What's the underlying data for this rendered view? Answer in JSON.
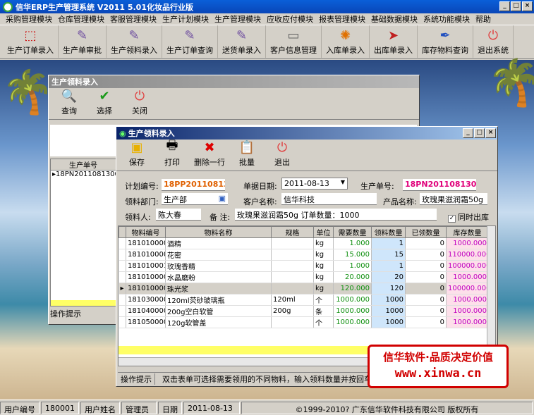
{
  "app": {
    "title": "信华ERP生产管理系统  V2011 5.01化妆品行业版"
  },
  "menu": [
    "采购管理模块",
    "仓库管理模块",
    "客服管理模块",
    "生产计划模块",
    "生产管理模块",
    "应收应付模块",
    "报表管理模块",
    "基础数据模块",
    "系统功能模块",
    "帮助"
  ],
  "toolbar": [
    {
      "label": "生产订单录入",
      "icon": "pdf-icon"
    },
    {
      "label": "生产单审批",
      "icon": "approve-icon"
    },
    {
      "label": "生产领料录入",
      "icon": "pick-icon"
    },
    {
      "label": "生产订单查询",
      "icon": "query-icon"
    },
    {
      "label": "送货单录入",
      "icon": "delivery-icon"
    },
    {
      "label": "客户信息管理",
      "icon": "customer-icon"
    },
    {
      "label": "入库单录入",
      "icon": "inbound-icon"
    },
    {
      "label": "出库单录入",
      "icon": "outbound-icon"
    },
    {
      "label": "库存物料查询",
      "icon": "stock-icon"
    },
    {
      "label": "退出系统",
      "icon": "exit-icon"
    }
  ],
  "back_window": {
    "title": "生产领料录入",
    "buttons": [
      {
        "label": "查询"
      },
      {
        "label": "选择"
      },
      {
        "label": "关闭"
      }
    ],
    "col_header": "生产单号",
    "row": "18PN20110813001",
    "hint_label": "操作提示"
  },
  "front_window": {
    "title": "生产领料录入",
    "buttons": [
      {
        "label": "保存"
      },
      {
        "label": "打印"
      },
      {
        "label": "删除一行"
      },
      {
        "label": "批量"
      },
      {
        "label": "退出"
      }
    ],
    "form": {
      "plan_no_label": "计划编号:",
      "plan_no": "18PP20110813001",
      "date_label": "单据日期:",
      "date": "2011-08-13",
      "prod_no_label": "生产单号:",
      "prod_no": "18PN20110813001",
      "dept_label": "领料部门:",
      "dept": "生产部",
      "customer_label": "客户名称:",
      "customer": "信华科技",
      "product_label": "产品名称:",
      "product": "玫瑰果滋润霜50g",
      "picker_label": "领料人:",
      "picker": "陈大春",
      "remark_label": "备  注:",
      "remark": "玫瑰果滋润霜50g 订单数量：1000",
      "checkbox_label": "同时出库"
    },
    "table": {
      "headers": [
        "物料编号",
        "物料名称",
        "规格",
        "单位",
        "需要数量",
        "领料数量",
        "已领数量",
        "库存数量"
      ],
      "rows": [
        [
          "1810100001",
          "酒精",
          "",
          "kg",
          "1.000",
          "1",
          "0",
          "1000.000"
        ],
        [
          "1810100006",
          "花密",
          "",
          "kg",
          "15.000",
          "15",
          "0",
          "110000.000"
        ],
        [
          "1810100012",
          "玫瑰香精",
          "",
          "kg",
          "1.000",
          "1",
          "0",
          "100000.000"
        ],
        [
          "1810100007",
          "水晶磨粉",
          "",
          "kg",
          "20.000",
          "20",
          "0",
          "1000.000"
        ],
        [
          "1810100008",
          "珠光浆",
          "",
          "kg",
          "120.000",
          "120",
          "0",
          "100000.000"
        ],
        [
          "1810300001",
          "120ml荧砂玻璃瓶",
          "120ml",
          "个",
          "1000.000",
          "1000",
          "0",
          "1000.000"
        ],
        [
          "1810400001",
          "200g空白软管",
          "200g",
          "条",
          "1000.000",
          "1000",
          "0",
          "1000.000"
        ],
        [
          "1810500004",
          "120g软管盖",
          "",
          "个",
          "1000.000",
          "1000",
          "0",
          "1000.000"
        ]
      ]
    },
    "hint_label": "操作提示",
    "hint_text": "双击表单可选择需要领用的不同物料，输入领料数量并按回车"
  },
  "ad": {
    "line1": "信华软件·品质决定价值",
    "line2": "www.xinwa.cn"
  },
  "status": {
    "user_no_label": "用户编号",
    "user_no": "180001",
    "user_name_label": "用户姓名",
    "user_name": "管理员",
    "date_label": "日期",
    "date": "2011-08-13",
    "copyright": "©1999-2010?  广东信华软件科技有限公司   版权所有"
  }
}
